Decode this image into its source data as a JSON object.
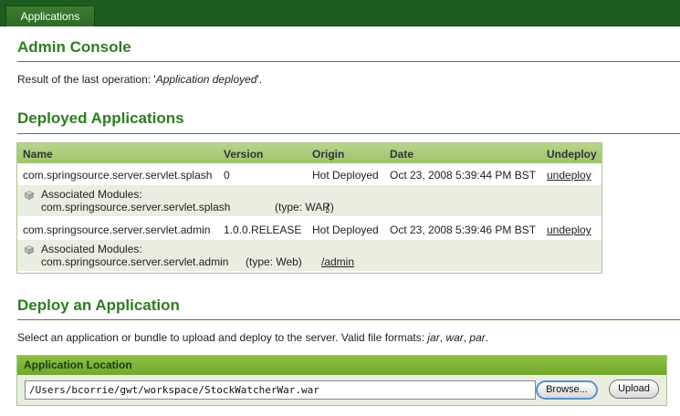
{
  "tab": {
    "label": "Applications"
  },
  "admin": {
    "title": "Admin Console",
    "result_prefix": "Result of the last operation: '",
    "result_value": "Application deployed",
    "result_suffix": "'."
  },
  "deployed": {
    "title": "Deployed Applications",
    "columns": {
      "name": "Name",
      "version": "Version",
      "origin": "Origin",
      "date": "Date",
      "undeploy": "Undeploy"
    },
    "rows": [
      {
        "name": "com.springsource.server.servlet.splash",
        "version": "0",
        "origin": "Hot Deployed",
        "date": "Oct 23, 2008 5:39:44 PM BST",
        "undeploy": "undeploy",
        "modules_label": "Associated Modules:",
        "module_name": "com.springsource.server.servlet.splash",
        "module_type": "(type: WAR)",
        "module_path": "/"
      },
      {
        "name": "com.springsource.server.servlet.admin",
        "version": "1.0.0.RELEASE",
        "origin": "Hot Deployed",
        "date": "Oct 23, 2008 5:39:46 PM BST",
        "undeploy": "undeploy",
        "modules_label": "Associated Modules:",
        "module_name": "com.springsource.server.servlet.admin",
        "module_type": "(type: Web)",
        "module_path": "/admin"
      }
    ]
  },
  "deploy": {
    "title": "Deploy an Application",
    "desc_prefix": "Select an application or bundle to upload and deploy to the server. Valid file formats: ",
    "formats": [
      "jar",
      "war",
      "par"
    ],
    "desc_suffix": ".",
    "location_label": "Application Location",
    "path_value": "/Users/bcorrie/gwt/workspace/StockWatcherWar.war",
    "browse_label": "Browse...",
    "upload_label": "Upload"
  },
  "colors": {
    "header_green": "#1f5c1f",
    "title_green": "#2f7d21",
    "table_header": "#a9c97a",
    "row_alt": "#eaeee0"
  },
  "icons": {
    "module": "package-icon"
  }
}
